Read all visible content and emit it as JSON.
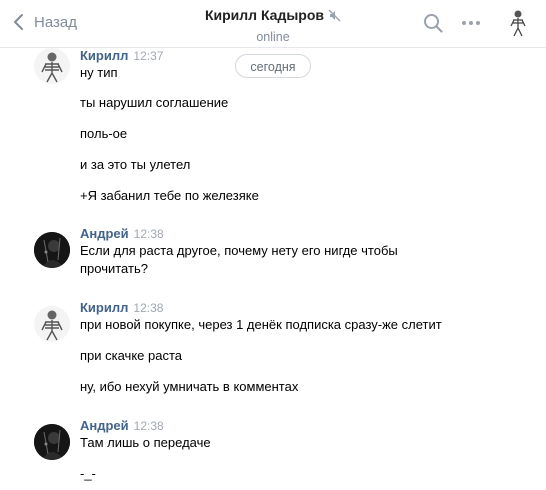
{
  "header": {
    "back_label": "Назад",
    "title": "Кирилл Кадыров",
    "status": "online"
  },
  "feed": {
    "date_divider": "сегодня",
    "groups": [
      {
        "author": "Кирилл",
        "time": "12:37",
        "messages": [
          "ну тип",
          "ты нарушил соглашение",
          "поль-ое",
          "и за это ты улетел",
          "+Я забанил тебе по железяке"
        ]
      },
      {
        "author": "Андрей",
        "time": "12:38",
        "messages": [
          "Если для раста другое, почему нету его нигде чтобы",
          "прочитать?"
        ]
      },
      {
        "author": "Кирилл",
        "time": "12:38",
        "messages": [
          "при новой покупке, через 1 денёк подписка сразу-же слетит",
          "при скачке раста",
          "ну, ибо нехуй умничать в комментах"
        ]
      },
      {
        "author": "Андрей",
        "time": "12:38",
        "messages": [
          "Там лишь о передаче",
          "-_-"
        ]
      }
    ]
  },
  "colors": {
    "author_link": "#42648b",
    "muted_text": "#818c99",
    "divider": "#e7e8ec"
  },
  "icons": [
    "chevron-left-icon",
    "mute-icon",
    "search-icon",
    "more-icon"
  ]
}
